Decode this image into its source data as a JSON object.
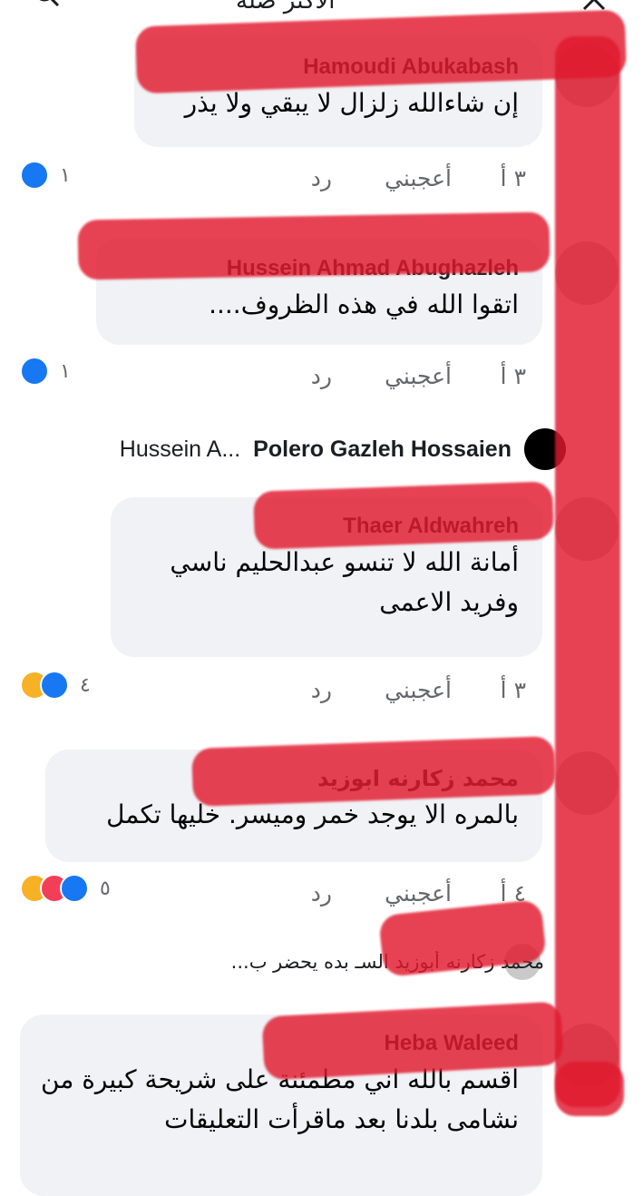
{
  "header": {
    "title": "الأكثر صلة"
  },
  "actions": {
    "like": "أعجبني",
    "reply": "رد"
  },
  "comments": [
    {
      "author": "Hamoudi Abukabash",
      "text": "إن شاءالله زلزال لا يبقي ولا يذر",
      "time": "٣ أ",
      "reaction_count": "١"
    },
    {
      "author": "Hussein Ahmad Abughazleh",
      "text": "اتقوا الله في هذه الظروف....",
      "time": "٣ أ",
      "reaction_count": "١"
    },
    {
      "author": "Thaer Aldwahreh",
      "text": "أمانة الله لا تنسو عبدالحليم ناسي وفريد الاعمى",
      "time": "٣ أ",
      "reaction_count": "٤"
    },
    {
      "author": "محمد زكارنه ابوزيد",
      "text": "بالمره الا يوجد خمر وميسر. خليها تكمل",
      "time": "٤ أ",
      "reaction_count": "٥"
    },
    {
      "author": "Heba Waleed",
      "text": "اقسم بالله اني مطمئنة على شريحة كبيرة من نشامى بلدنا بعد ماقرأت التعليقات"
    }
  ],
  "reply_summary_1": {
    "author": "Polero Gazleh Hossaien",
    "others": "Hussein A..."
  },
  "reply_summary_2": {
    "text": "محمد زكارنه أبوزيد السـ بده يحضر ب..."
  }
}
